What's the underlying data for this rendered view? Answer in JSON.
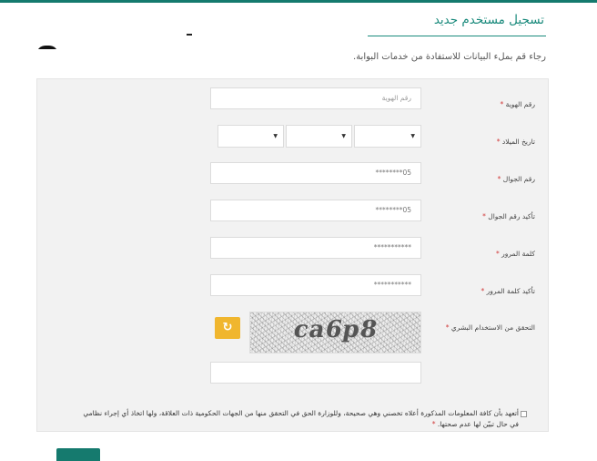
{
  "page": {
    "title": "تسجيل مستخدم جديد",
    "subtitle": "رجاء قم بملء البيانات للاستفادة من خدمات البوابة."
  },
  "form": {
    "required_mark": "*",
    "id": {
      "label": "رقم الهوية",
      "placeholder": "رقم الهوية"
    },
    "dob": {
      "label": "تاريخ الميلاد",
      "options": [
        "",
        "",
        ""
      ]
    },
    "mobile": {
      "label": "رقم الجوال",
      "value": "05********"
    },
    "mobile_confirm": {
      "label": "تأكيد رقم الجوال",
      "value": "05********"
    },
    "password": {
      "label": "كلمة المرور",
      "value": "***********"
    },
    "password_confirm": {
      "label": "تأكيد كلمة المرور",
      "value": "***********"
    },
    "captcha": {
      "label": "التحقق من الاستخدام البشري",
      "image_text": "ca6p8",
      "input_value": ""
    },
    "agreement": "أتعهد بأن كافة المعلومات المذكورة أعلاه تخصني وهي صحيحة، وللوزارة الحق في التحقق منها من الجهات الحكومية ذات العلاقة، ولها اتخاذ أي إجراء نظامي في حال تبيّن لها عدم صحتها."
  },
  "icons": {
    "refresh": "refresh-icon",
    "dropdown": "chevron-down-icon"
  },
  "colors": {
    "brand": "#157a6e",
    "accent": "#f0b62e",
    "required": "#d13b3b"
  }
}
